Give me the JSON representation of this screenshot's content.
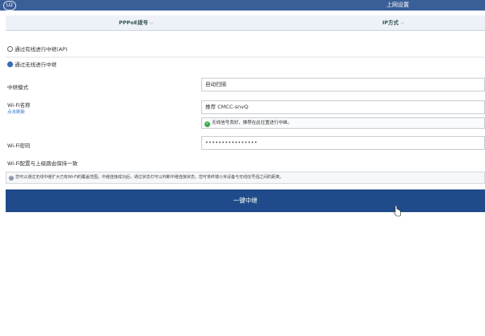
{
  "header": {
    "logo_text": "U2",
    "title": "上网设置"
  },
  "subnav": {
    "items": [
      {
        "label": "PPPoE拨号",
        "chevron": "chevron-down-icon"
      },
      {
        "label": "IP方式",
        "chevron": "chevron-down-icon"
      }
    ]
  },
  "options": {
    "wired": {
      "label": "通过有线进行中继(AP)",
      "checked": false
    },
    "wireless": {
      "label": "通过无线进行中继",
      "checked": true
    }
  },
  "form": {
    "mode_label": "中继模式",
    "mode_value": "自动扫描",
    "ssid_label": "Wi-Fi名称",
    "ssid_sublink": "点击刷新",
    "ssid_value": "推荐  CMCC-snvQ",
    "ssid_status": "无线信号良好，推荐在此位置进行中继。",
    "password_label": "Wi-Fi密码",
    "password_value": "••••••••••••••••",
    "sync_note": "Wi-Fi配置与上级路由保持一致"
  },
  "tip": "您可以通过无线中继扩大已有Wi-Fi的覆盖范围。中继连接成功后，通过状态灯可以判断中继连接状态，您可将终端小米设备与无线信号强之间的距离。",
  "action": {
    "button_label": "一键中继"
  },
  "colors": {
    "header_bg": "#3a5f98",
    "button_bg": "#1f4b8a",
    "status_ok": "#3aa94a",
    "link": "#2e73c8"
  }
}
